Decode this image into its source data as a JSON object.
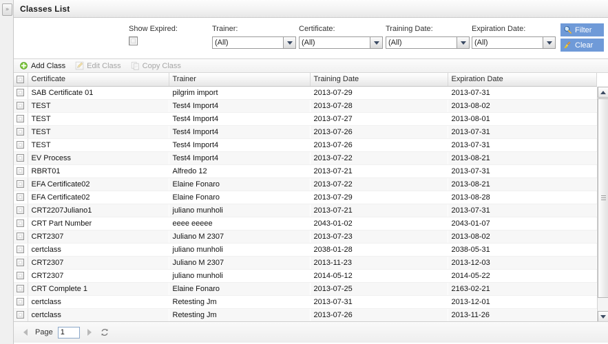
{
  "window": {
    "title": "Classes List",
    "collapse_glyph": "»"
  },
  "filters": {
    "show_expired": {
      "label": "Show Expired:",
      "checked": false
    },
    "trainer": {
      "label": "Trainer:",
      "value": "(All)"
    },
    "certificate": {
      "label": "Certificate:",
      "value": "(All)"
    },
    "training_date": {
      "label": "Training Date:",
      "value": "(All)"
    },
    "expiration_date": {
      "label": "Expiration Date:",
      "value": "(All)"
    },
    "buttons": {
      "filter": "Filter",
      "clear": "Clear",
      "accent_color": "#6f9ad8"
    }
  },
  "toolbar": {
    "add": "Add Class",
    "edit": "Edit Class",
    "copy": "Copy Class"
  },
  "grid": {
    "columns": [
      "Certificate",
      "Trainer",
      "Training Date",
      "Expiration Date"
    ],
    "rows": [
      {
        "certificate": "SAB Certificate 01",
        "trainer": "pilgrim import",
        "training_date": "2013-07-29",
        "expiration_date": "2013-07-31"
      },
      {
        "certificate": "TEST",
        "trainer": "Test4 Import4",
        "training_date": "2013-07-28",
        "expiration_date": "2013-08-02"
      },
      {
        "certificate": "TEST",
        "trainer": "Test4 Import4",
        "training_date": "2013-07-27",
        "expiration_date": "2013-08-01"
      },
      {
        "certificate": "TEST",
        "trainer": "Test4 Import4",
        "training_date": "2013-07-26",
        "expiration_date": "2013-07-31"
      },
      {
        "certificate": "TEST",
        "trainer": "Test4 Import4",
        "training_date": "2013-07-26",
        "expiration_date": "2013-07-31"
      },
      {
        "certificate": "EV Process",
        "trainer": "Test4 Import4",
        "training_date": "2013-07-22",
        "expiration_date": "2013-08-21"
      },
      {
        "certificate": "RBRT01",
        "trainer": "Alfredo 12",
        "training_date": "2013-07-21",
        "expiration_date": "2013-07-31"
      },
      {
        "certificate": "EFA Certificate02",
        "trainer": "Elaine Fonaro",
        "training_date": "2013-07-22",
        "expiration_date": "2013-08-21"
      },
      {
        "certificate": "EFA Certificate02",
        "trainer": "Elaine Fonaro",
        "training_date": "2013-07-29",
        "expiration_date": "2013-08-28"
      },
      {
        "certificate": "CRT2207Juliano1",
        "trainer": "juliano munholi",
        "training_date": "2013-07-21",
        "expiration_date": "2013-07-31"
      },
      {
        "certificate": "CRT Part Number",
        "trainer": "eeee eeeee",
        "training_date": "2043-01-02",
        "expiration_date": "2043-01-07"
      },
      {
        "certificate": "CRT2307",
        "trainer": "Juliano M 2307",
        "training_date": "2013-07-23",
        "expiration_date": "2013-08-02"
      },
      {
        "certificate": "certclass",
        "trainer": "juliano munholi",
        "training_date": "2038-01-28",
        "expiration_date": "2038-05-31"
      },
      {
        "certificate": "CRT2307",
        "trainer": "Juliano M 2307",
        "training_date": "2013-11-23",
        "expiration_date": "2013-12-03"
      },
      {
        "certificate": "CRT2307",
        "trainer": "juliano munholi",
        "training_date": "2014-05-12",
        "expiration_date": "2014-05-22"
      },
      {
        "certificate": "CRT Complete 1",
        "trainer": "Elaine Fonaro",
        "training_date": "2013-07-25",
        "expiration_date": "2163-02-21"
      },
      {
        "certificate": "certclass",
        "trainer": "Retesting Jm",
        "training_date": "2013-07-31",
        "expiration_date": "2013-12-01"
      },
      {
        "certificate": "certclass",
        "trainer": "Retesting Jm",
        "training_date": "2013-07-26",
        "expiration_date": "2013-11-26"
      }
    ]
  },
  "footer": {
    "page_label": "Page",
    "page_value": "1"
  }
}
